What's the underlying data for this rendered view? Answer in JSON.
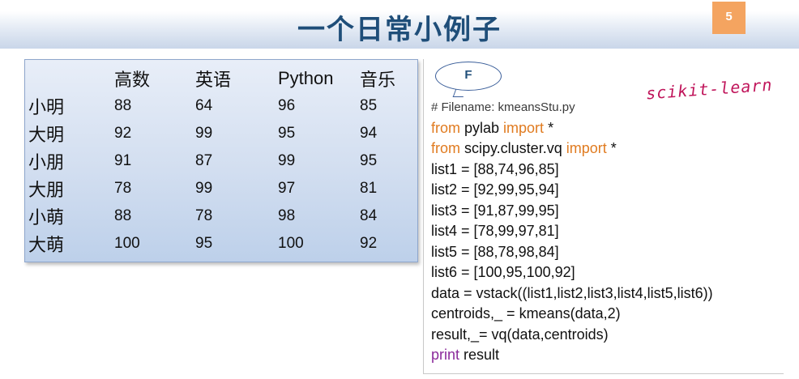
{
  "slide": {
    "title": "一个日常小例子",
    "page_number": "5"
  },
  "scores_table": {
    "headers": [
      "",
      "高数",
      "英语",
      "Python",
      "音乐"
    ],
    "rows": [
      {
        "name": "小明",
        "values": [
          "88",
          "64",
          "96",
          "85"
        ]
      },
      {
        "name": "大明",
        "values": [
          "92",
          "99",
          "95",
          "94"
        ]
      },
      {
        "name": "小朋",
        "values": [
          "91",
          "87",
          "99",
          "95"
        ]
      },
      {
        "name": "大朋",
        "values": [
          "78",
          "99",
          "97",
          "81"
        ]
      },
      {
        "name": "小萌",
        "values": [
          "88",
          "78",
          "98",
          "84"
        ]
      },
      {
        "name": "大萌",
        "values": [
          "100",
          "95",
          "100",
          "92"
        ]
      }
    ]
  },
  "callout": {
    "label": "F"
  },
  "annotation": {
    "handwritten": "scikit-learn"
  },
  "code": {
    "comment": "# Filename: kmeansStu.py",
    "import1": {
      "kw1": "from",
      "mod": " pylab ",
      "kw2": "import",
      "rest": " *"
    },
    "import2": {
      "kw1": "from",
      "mod": " scipy.cluster.vq ",
      "kw2": "import",
      "rest": " *"
    },
    "lines": [
      "list1 = [88,74,96,85]",
      "list2 = [92,99,95,94]",
      "list3 = [91,87,99,95]",
      "list4 = [78,99,97,81]",
      "list5 = [88,78,98,84]",
      "list6 = [100,95,100,92]",
      "data = vstack((list1,list2,list3,list4,list5,list6))",
      "centroids,_ = kmeans(data,2)",
      "result,_= vq(data,centroids)"
    ],
    "print_kw": "print",
    "print_rest": " result"
  },
  "colors": {
    "title": "#1f4e79",
    "page_badge": "#f4a460",
    "keyword": "#e07b20",
    "print_keyword": "#8b2a9b",
    "handwriting": "#c0145a"
  }
}
